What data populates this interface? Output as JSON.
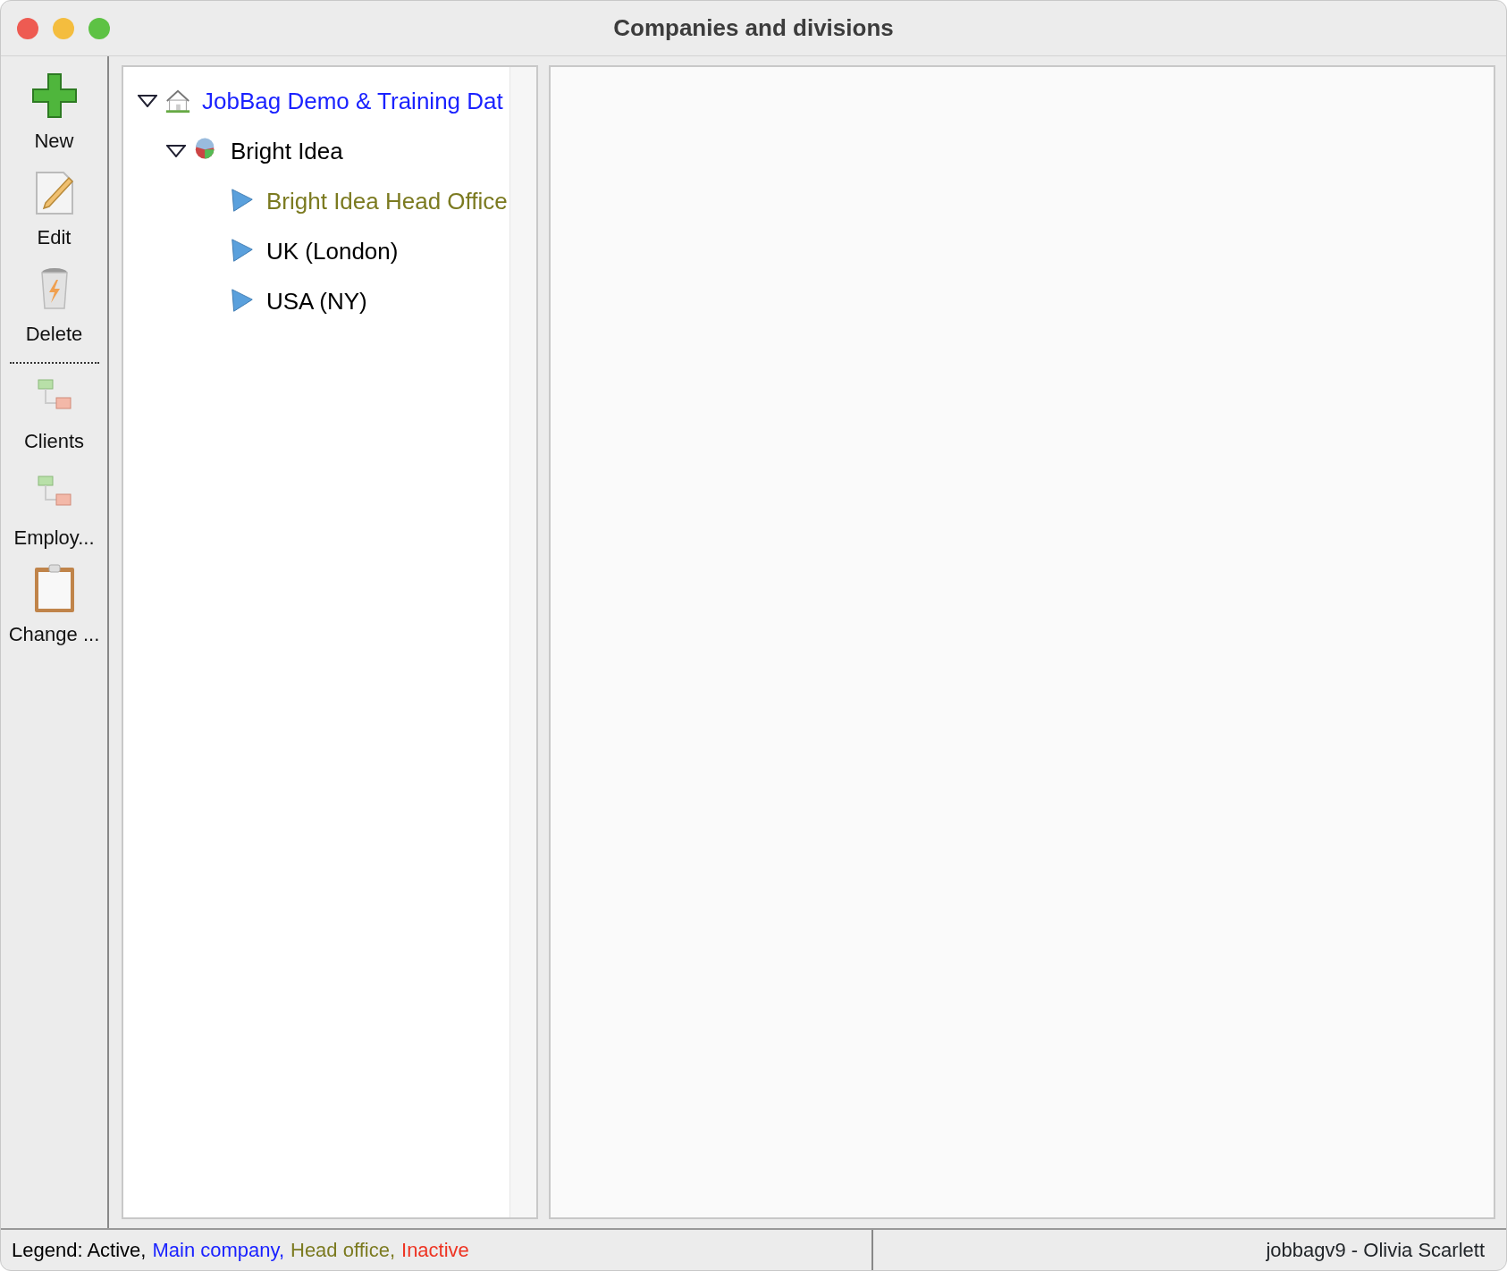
{
  "window": {
    "title": "Companies and divisions"
  },
  "toolbar": [
    {
      "kind": "plus",
      "label": "New"
    },
    {
      "kind": "edit",
      "label": "Edit"
    },
    {
      "kind": "trash",
      "label": "Delete"
    },
    {
      "kind": "separator"
    },
    {
      "kind": "hierarchy",
      "label": "Clients"
    },
    {
      "kind": "hierarchy",
      "label": "Employ..."
    },
    {
      "kind": "clipboard",
      "label": "Change ..."
    }
  ],
  "tree": [
    {
      "kind": "main",
      "label": "JobBag Demo & Training Dat",
      "expanded": true,
      "children": [
        {
          "kind": "active",
          "label": "Bright Idea",
          "expanded": true,
          "children": [
            {
              "kind": "head_office",
              "label": "Bright Idea Head Office"
            },
            {
              "kind": "active",
              "label": "UK (London)"
            },
            {
              "kind": "active",
              "label": "USA (NY)"
            }
          ]
        }
      ]
    }
  ],
  "status_bar": {
    "legend": [
      {
        "kind": "active",
        "text": "Legend: Active,"
      },
      {
        "kind": "main",
        "text": "Main company,"
      },
      {
        "kind": "head_office",
        "text": "Head office,"
      },
      {
        "kind": "inactive",
        "text": "Inactive"
      }
    ],
    "user": "jobbagv9 - Olivia Scarlett"
  }
}
